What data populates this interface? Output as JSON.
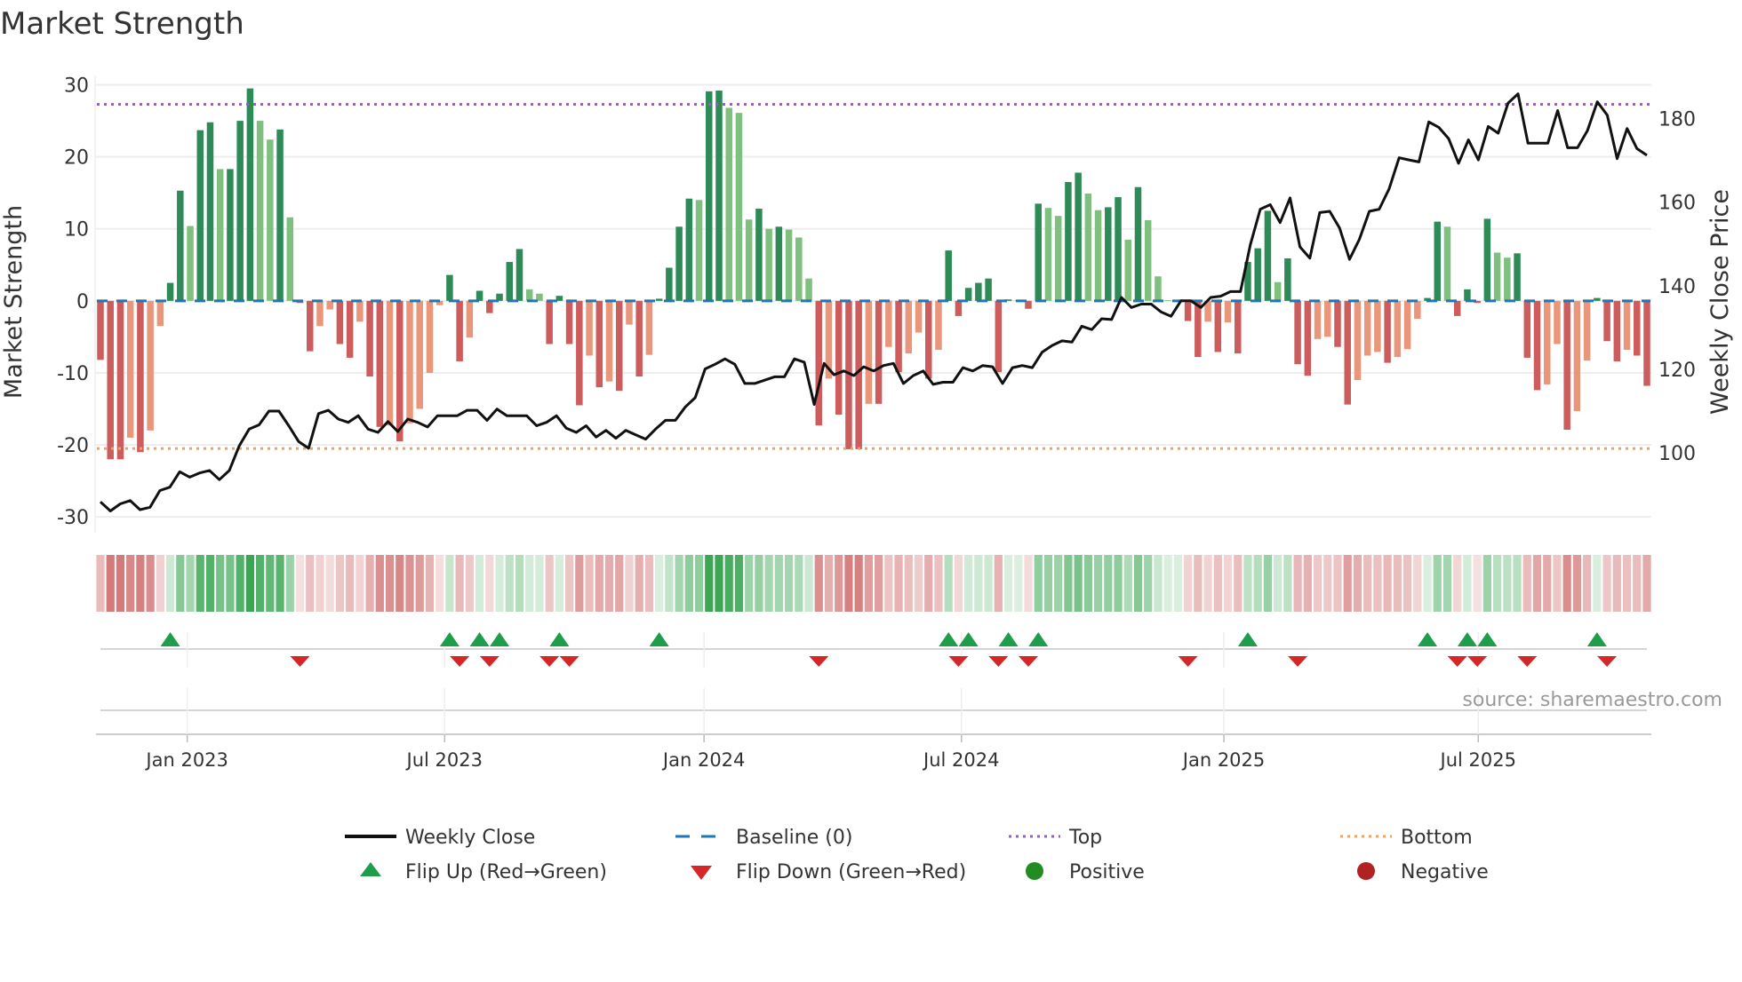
{
  "chart_data": {
    "type": "bar",
    "title": "Market Strength",
    "ylabel": "Market Strength",
    "y2label": "Weekly Close Price",
    "ylim": [
      -32.2,
      31.3
    ],
    "y2lim": [
      80.9,
      190.3
    ],
    "yticks": [
      30,
      20,
      10,
      0,
      -10,
      -20,
      -30
    ],
    "y2ticks": [
      180,
      160,
      140,
      120,
      100
    ],
    "top_level": 27.3,
    "bottom_level": -20.5,
    "grid": true,
    "xticks": [
      {
        "label": "Jan 2023",
        "week": 8.7
      },
      {
        "label": "Jul 2023",
        "week": 34.5
      },
      {
        "label": "Jan 2024",
        "week": 60.5
      },
      {
        "label": "Jul 2024",
        "week": 86.3
      },
      {
        "label": "Jan 2025",
        "week": 112.6
      },
      {
        "label": "Jul 2025",
        "week": 138.1
      }
    ],
    "strength": [
      -8.2,
      -22,
      -22,
      -19,
      -21,
      -18,
      -3.5,
      2.5,
      15.3,
      10.4,
      23.7,
      24.8,
      18.3,
      18.3,
      25,
      29.5,
      25,
      22.4,
      23.8,
      11.6,
      -0.3,
      -7,
      -3.5,
      -1.2,
      -6,
      -7.9,
      -2.9,
      -10.5,
      -17.5,
      -17.3,
      -19.5,
      -17,
      -15,
      -10,
      -0.6,
      3.6,
      -8.4,
      -5.1,
      1.4,
      -1.7,
      1,
      5.4,
      7.2,
      1.6,
      1,
      -6,
      0.7,
      -6,
      -14.5,
      -7.6,
      -12,
      -11.2,
      -12.5,
      -3.3,
      -10.5,
      -7.5,
      0.3,
      4.6,
      10.3,
      14.2,
      14,
      29.1,
      29.2,
      26.8,
      26.1,
      11.3,
      12.8,
      10,
      10.3,
      9.9,
      8.8,
      3.1,
      -17.3,
      -10.8,
      -15.8,
      -20.6,
      -20.6,
      -14.3,
      -14.3,
      -6.4,
      -9.9,
      -7.3,
      -4.4,
      -10.8,
      -6.8,
      7,
      -2.1,
      1.8,
      2.5,
      3.1,
      -9.9,
      0.2,
      0.1,
      -1.1,
      13.5,
      12.9,
      11.8,
      16.5,
      17.8,
      14.9,
      12.6,
      13,
      14.4,
      8.5,
      15.8,
      11.2,
      3.4,
      0.1,
      0.1,
      -2.8,
      -7.8,
      -2.9,
      -7.1,
      -3,
      -7.3,
      5.4,
      7.3,
      12.5,
      2.6,
      5.9,
      -8.8,
      -10.4,
      -5.3,
      -5,
      -6.4,
      -14.4,
      -11,
      -7.6,
      -7.1,
      -8.6,
      -7.8,
      -6.7,
      -2.5,
      0.4,
      11,
      10.3,
      -2.1,
      1.6,
      -0.3,
      11.4,
      6.7,
      6,
      6.6,
      -7.9,
      -12.4,
      -11.6,
      -6,
      -17.9,
      -15.3,
      -8.3,
      0.4,
      -5.6,
      -8.4,
      -6.8,
      -7.6,
      -11.8
    ],
    "weekly_close": [
      88.3,
      86.1,
      87.8,
      88.6,
      86.4,
      87.0,
      91.0,
      91.8,
      95.5,
      94.2,
      95.2,
      95.8,
      93.6,
      95.8,
      101.7,
      105.7,
      106.7,
      110.0,
      110.0,
      106.5,
      102.7,
      101.1,
      109.4,
      110.2,
      108.1,
      107.3,
      108.9,
      105.7,
      104.9,
      107.5,
      105.1,
      108.1,
      107.3,
      106.2,
      108.9,
      108.9,
      108.9,
      110.2,
      110.2,
      107.8,
      110.5,
      108.9,
      108.9,
      108.9,
      106.5,
      107.3,
      108.9,
      105.9,
      104.9,
      106.5,
      103.8,
      105.4,
      103.5,
      105.4,
      104.3,
      103.3,
      105.7,
      107.8,
      107.8,
      111.0,
      113.2,
      120.1,
      121.2,
      122.5,
      121.2,
      116.6,
      116.6,
      117.4,
      118.2,
      118.2,
      122.5,
      121.7,
      111.6,
      121.4,
      118.7,
      119.6,
      118.5,
      120.6,
      119.6,
      120.9,
      121.4,
      116.6,
      118.5,
      119.6,
      116.4,
      116.9,
      116.9,
      120.4,
      119.6,
      120.9,
      120.6,
      116.6,
      120.4,
      120.9,
      120.4,
      124.1,
      125.7,
      126.8,
      126.5,
      130.3,
      129.5,
      132.1,
      131.9,
      137.2,
      134.8,
      135.6,
      135.6,
      133.7,
      132.7,
      136.4,
      136.4,
      134.8,
      137.2,
      137.5,
      138.6,
      138.6,
      149.8,
      158.3,
      159.4,
      155.1,
      161.0,
      149.3,
      146.6,
      157.5,
      157.8,
      153.8,
      146.3,
      151.1,
      157.8,
      158.3,
      163.2,
      170.6,
      170.1,
      169.6,
      179.2,
      177.9,
      175.2,
      169.3,
      174.9,
      170.1,
      178.1,
      176.5,
      183.7,
      185.9,
      174.1,
      174.1,
      174.1,
      181.9,
      173.0,
      173.0,
      177.1,
      184.0,
      180.8,
      170.4,
      177.6,
      172.8,
      171.2
    ],
    "legend": {
      "placement": "bottom",
      "items": [
        {
          "label": "Weekly Close",
          "kind": "line"
        },
        {
          "label": "Baseline (0)",
          "kind": "dash"
        },
        {
          "label": "Top",
          "kind": "dot-top"
        },
        {
          "label": "Bottom",
          "kind": "dot-bottom"
        },
        {
          "label": "Flip Up (Red→Green)",
          "kind": "tri-up"
        },
        {
          "label": "Flip Down (Green→Red)",
          "kind": "tri-down"
        },
        {
          "label": "Positive",
          "kind": "dot-pos"
        },
        {
          "label": "Negative",
          "kind": "dot-neg"
        }
      ]
    },
    "source": "source: sharemaestro.com"
  },
  "colors": {
    "pos_strong": "#2e8b57",
    "pos_weak": "#7fbf7f",
    "neg_strong": "#cd5c5c",
    "neg_weak": "#e9967a",
    "line": "#111111",
    "baseline": "#1f77b4",
    "top": "#9b59d0",
    "bottom": "#f0a060",
    "flip_up": "#1e9e4a",
    "flip_down": "#d62728",
    "positive": "#228b22",
    "negative": "#b22222"
  }
}
